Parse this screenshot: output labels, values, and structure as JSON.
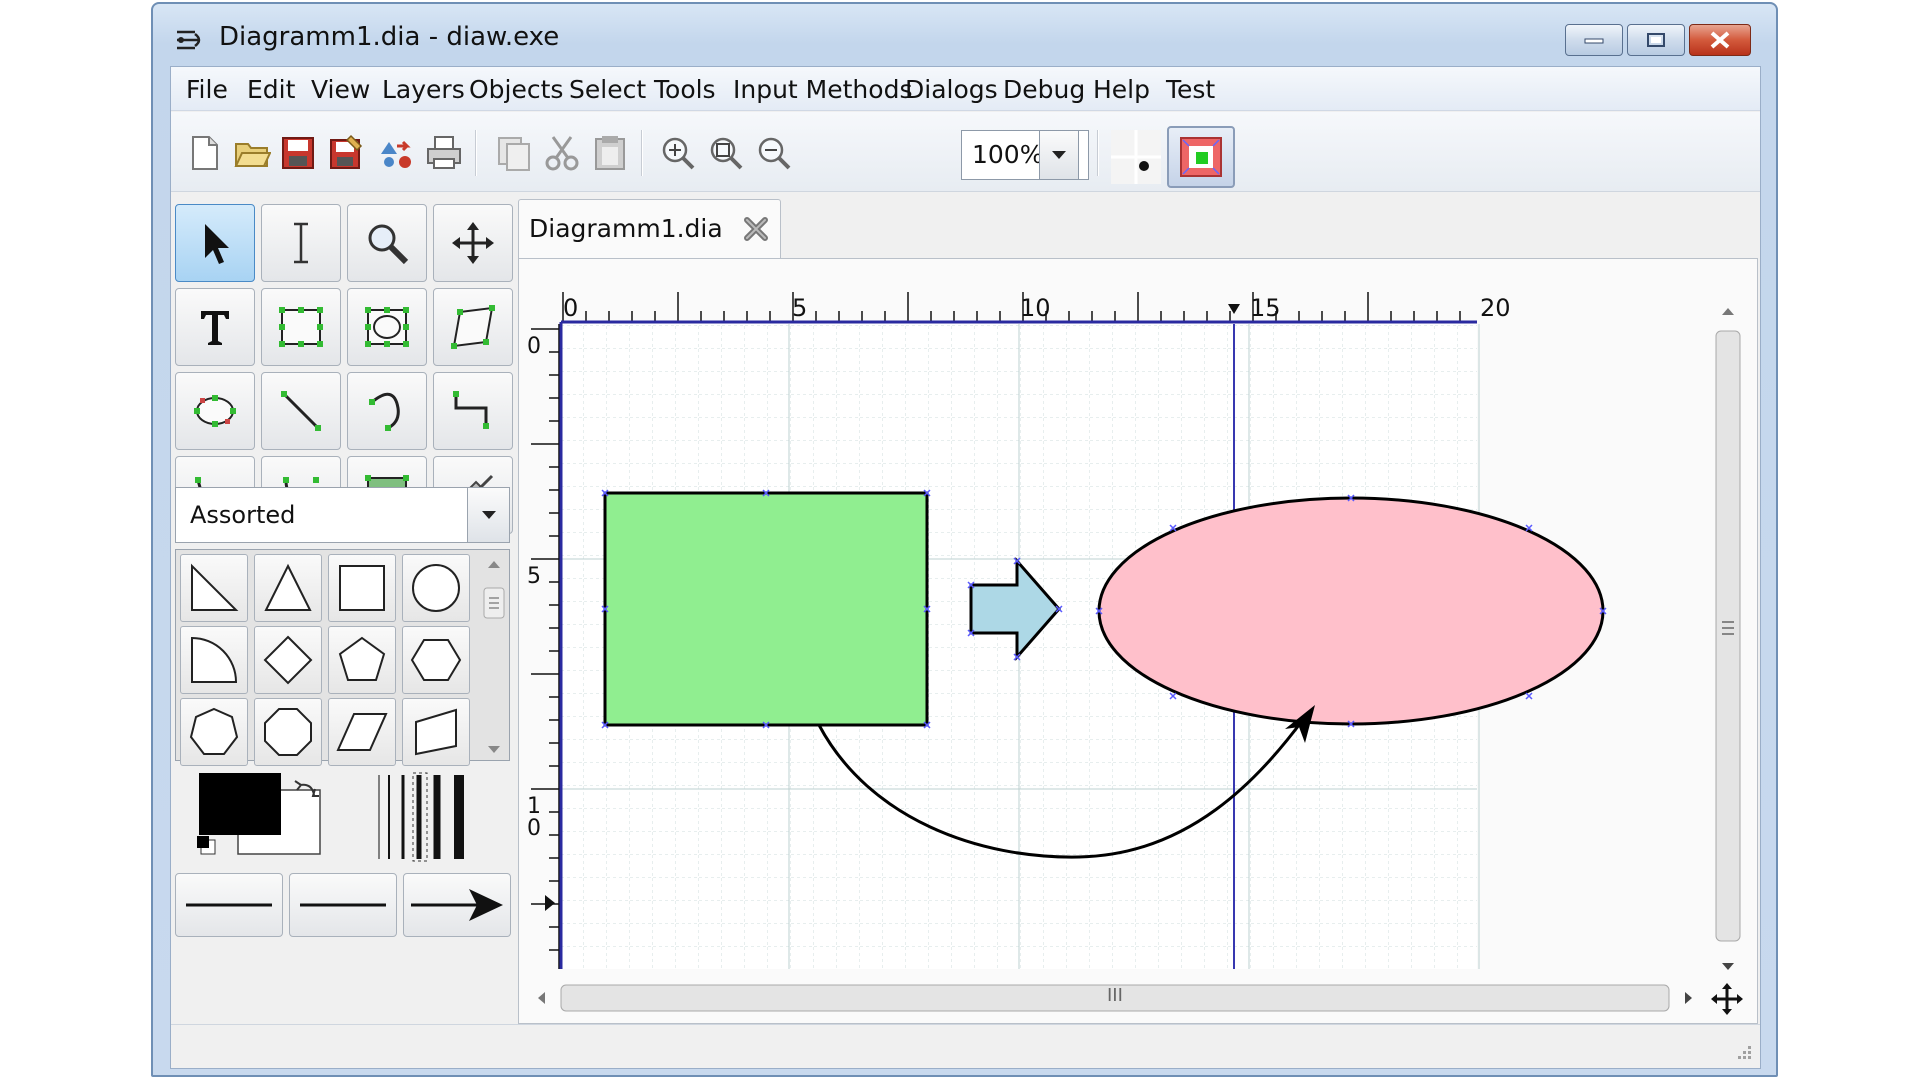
{
  "window": {
    "title": "Diagramm1.dia - diaw.exe",
    "accent_color": "#d35a3c"
  },
  "menu": {
    "items": [
      "File",
      "Edit",
      "View",
      "Layers",
      "Objects",
      "Select",
      "Tools",
      "Input Methods",
      "Dialogs",
      "Debug",
      "Help",
      "Test"
    ]
  },
  "toolbar": {
    "icons": [
      "new-file-icon",
      "open-folder-icon",
      "save-icon",
      "save-as-icon",
      "export-icon",
      "print-icon",
      "copy-icon",
      "cut-icon",
      "paste-icon",
      "zoom-in-icon",
      "zoom-fit-icon",
      "zoom-out-icon"
    ],
    "zoom": "100%"
  },
  "tools": {
    "icons": [
      "pointer-icon",
      "text-cursor-icon",
      "magnify-icon",
      "move-icon",
      "text-tool-icon",
      "box-icon",
      "ellipse-box-icon",
      "polygon-icon",
      "ellipse-icon",
      "line-icon",
      "arc-icon",
      "zigzag-line-icon",
      "polyline-icon",
      "bezier-icon",
      "image-icon",
      "outline-icon"
    ]
  },
  "sheet": {
    "selected": "Assorted"
  },
  "shapes": {
    "icons": [
      "right-triangle-icon",
      "triangle-icon",
      "square-icon",
      "circle-icon",
      "quarter-circle-icon",
      "diamond-icon",
      "pentagon-icon",
      "hexagon-icon",
      "heptagon-icon",
      "octagon-icon",
      "parallelogram-icon",
      "trapezoid-icon"
    ]
  },
  "document": {
    "tab_label": "Diagramm1.dia",
    "ruler_x_labels": [
      "0",
      "5",
      "10",
      "15",
      "20"
    ],
    "ruler_y_labels": [
      "0",
      "5",
      "1\n0"
    ],
    "scroll_grip": "III"
  },
  "diagram": {
    "rect_fill": "#90ee90",
    "ellipse_fill": "#ffc0cb",
    "arrow_fill": "#add8e6"
  }
}
